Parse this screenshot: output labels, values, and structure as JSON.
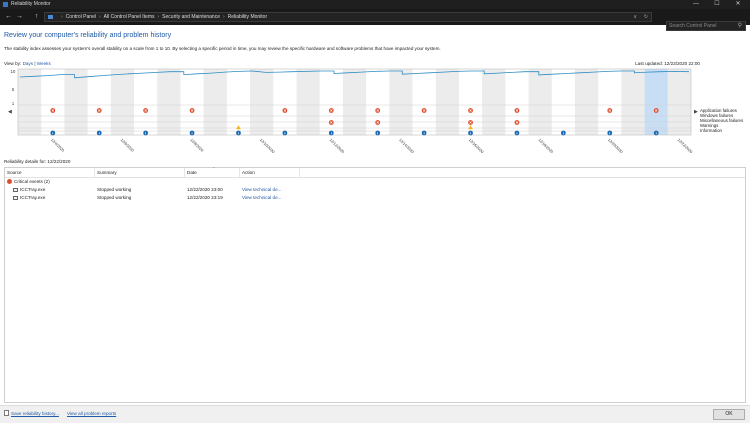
{
  "window": {
    "title": "Reliability Monitor",
    "minimize": "—",
    "maximize": "☐",
    "close": "✕"
  },
  "nav": {
    "back": "←",
    "forward": "→",
    "up": "↑"
  },
  "address": {
    "crumbs": [
      "Control Panel",
      "All Control Panel Items",
      "Security and Maintenance",
      "Reliability Monitor"
    ],
    "dropdown": "∨",
    "refresh": "↻"
  },
  "search": {
    "placeholder": "Search Control Panel",
    "icon": "search-icon"
  },
  "heading": "Review your computer's reliability and problem history",
  "description": "The stability index assesses your system's overall stability on a scale from 1 to 10. By selecting a specific period in time, you may review the specific hardware and software problems that have impacted your system.",
  "viewby": {
    "label": "View by:",
    "days": "Days",
    "separator": "|",
    "weeks": "Weeks"
  },
  "last_updated": "Last updated: 12/23/2020 22:00",
  "chart_data": {
    "type": "line",
    "y_ticks": [
      "10",
      "5",
      "1"
    ],
    "ylim": [
      1,
      10
    ],
    "stability_index": [
      8.3,
      8.5,
      8.7,
      9.0,
      8.1,
      8.4,
      8.7,
      9.0,
      9.2,
      9.4,
      9.6,
      9.8,
      9.0,
      9.2,
      9.4,
      9.7,
      9.9,
      10.0,
      9.6,
      9.7,
      9.8,
      9.9,
      10.0,
      9.3,
      9.5,
      9.7,
      9.9,
      10.0,
      9.1,
      9.3,
      9.5,
      9.7,
      9.9,
      10.0,
      9.2,
      9.4,
      9.6,
      9.8,
      8.9,
      9.1,
      9.3,
      9.5,
      9.7,
      9.9,
      10.0,
      9.5,
      9.7,
      9.8,
      9.9,
      9.8
    ],
    "categories": [
      "Application failures",
      "Windows failures",
      "Miscellaneous failures",
      "Warnings",
      "Information"
    ],
    "date_labels": [
      "12/4/2020",
      "12/6/2020",
      "12/8/2020",
      "12/10/2020",
      "12/12/2020",
      "12/14/2020",
      "12/16/2020",
      "12/18/2020",
      "12/20/2020",
      "12/22/2020"
    ],
    "events": {
      "application_failures": [
        1,
        3,
        5,
        7,
        11,
        13,
        15,
        17,
        19,
        21,
        25,
        27
      ],
      "windows_failures": [],
      "miscellaneous_failures": [
        13,
        15,
        19,
        21
      ],
      "warnings": [
        9,
        19
      ],
      "information": [
        1,
        3,
        5,
        7,
        9,
        11,
        13,
        15,
        17,
        19,
        21,
        23,
        25,
        27
      ]
    },
    "selected_column": 27,
    "shaded_columns": [
      0,
      2,
      4,
      6,
      8,
      10,
      12,
      14,
      16,
      18,
      20,
      22,
      24,
      26,
      28
    ],
    "scroll_left": "◀",
    "scroll_right": "▶",
    "colors": {
      "line": "#2c8cc4",
      "error": "#e04c2b",
      "warning": "#f2b418",
      "info": "#1c69b3",
      "selected": "#c7def5",
      "shade": "#ececec"
    }
  },
  "details": {
    "title": "Reliability details for: 12/22/2020",
    "columns": [
      "Source",
      "Summary",
      "Date",
      "Action"
    ],
    "group": "Critical events (2)",
    "rows": [
      {
        "source": "ICCTray.exe",
        "summary": "Stopped working",
        "date": "12/22/2020 23:00",
        "action": "View technical de..."
      },
      {
        "source": "ICCTray.exe",
        "summary": "Stopped working",
        "date": "12/22/2020 23:19",
        "action": "View technical de..."
      }
    ]
  },
  "footer": {
    "save": "Save reliability history...",
    "view_all": "View all problem reports",
    "ok": "OK"
  }
}
